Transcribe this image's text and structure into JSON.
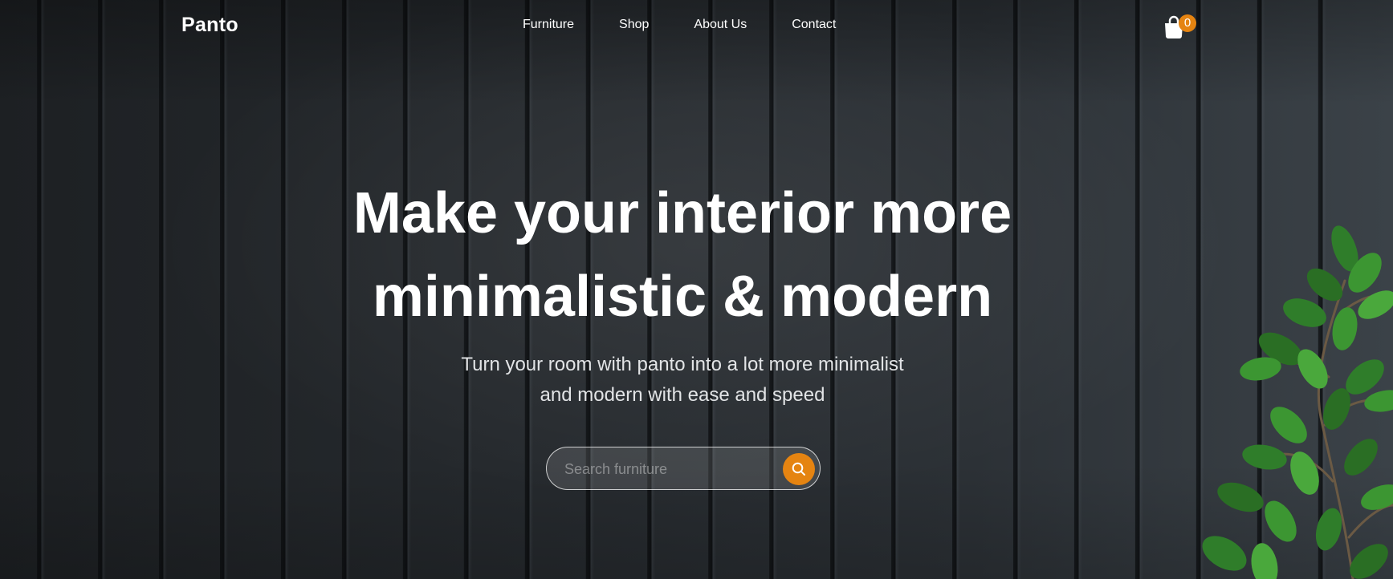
{
  "brand": {
    "name": "Panto"
  },
  "nav": {
    "items": [
      {
        "label": "Furniture"
      },
      {
        "label": "Shop"
      },
      {
        "label": "About Us"
      },
      {
        "label": "Contact"
      }
    ]
  },
  "cart": {
    "count": "0",
    "icon": "shopping-bag-icon",
    "badge_color": "#e58411"
  },
  "hero": {
    "headline_line1": "Make your interior more",
    "headline_line2": "minimalistic & modern",
    "subtitle_line1": "Turn your room with panto into a lot more minimalist",
    "subtitle_line2": "and modern with ease and speed"
  },
  "search": {
    "placeholder": "Search furniture",
    "value": "",
    "button_icon": "search-icon",
    "accent_color": "#e58411"
  }
}
